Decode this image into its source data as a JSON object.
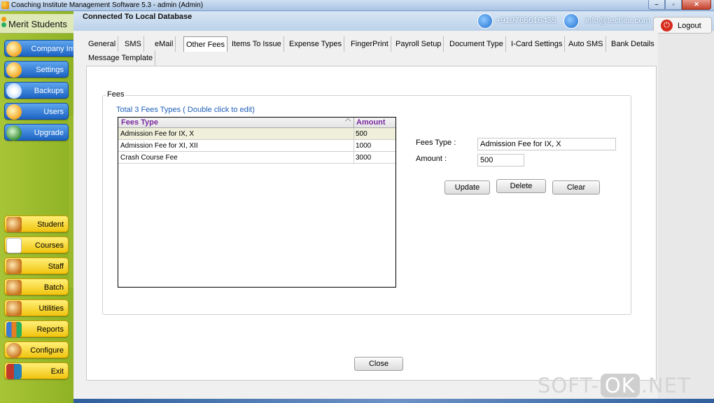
{
  "window": {
    "title": "Coaching Institute Management Software 5.3  -  admin (Admin)",
    "minimize_symbol": "–",
    "restore_symbol": "▫",
    "close_symbol": "✕"
  },
  "sidebar": {
    "brand": "Merit Students",
    "top_items": [
      {
        "label": "Company Info",
        "icon": "folder-icon"
      },
      {
        "label": "Settings",
        "icon": "gear-icon"
      },
      {
        "label": "Backups",
        "icon": "disc-icon"
      },
      {
        "label": "Users",
        "icon": "users-icon"
      },
      {
        "label": "Upgrade",
        "icon": "upgrade-icon"
      }
    ],
    "bottom_items": [
      {
        "label": "Student",
        "icon": "students-icon"
      },
      {
        "label": "Courses",
        "icon": "document-icon"
      },
      {
        "label": "Staff",
        "icon": "staff-icon"
      },
      {
        "label": "Batch",
        "icon": "batch-icon"
      },
      {
        "label": "Utilities",
        "icon": "toolbox-icon"
      },
      {
        "label": "Reports",
        "icon": "chart-icon"
      },
      {
        "label": "Configure",
        "icon": "configure-icon"
      },
      {
        "label": "Exit",
        "icon": "exit-icon"
      }
    ]
  },
  "header": {
    "connection": "Connected To  Local Database",
    "phone": "+919766616435",
    "email": "info@techior.com",
    "logout_label": "Logout"
  },
  "tabs": [
    {
      "label": "General"
    },
    {
      "label": "SMS"
    },
    {
      "label": "eMail"
    },
    {
      "label": "Other Fees",
      "active": true
    },
    {
      "label": "Items To Issue"
    },
    {
      "label": "Expense Types"
    },
    {
      "label": "FingerPrint"
    },
    {
      "label": "Payroll Setup"
    },
    {
      "label": "Document Type"
    },
    {
      "label": "I-Card Settings"
    },
    {
      "label": "Auto SMS"
    },
    {
      "label": "Bank Details"
    },
    {
      "label": "Message Template"
    }
  ],
  "fees": {
    "group_title": "Fees",
    "count_label": "Total 3 Fees Types ( Double click to edit)",
    "columns": [
      "Fees Type",
      "Amount"
    ],
    "rows": [
      {
        "type": "Admission Fee for IX, X",
        "amount": "500",
        "selected": true
      },
      {
        "type": "Admission Fee for XI, XII",
        "amount": "1000"
      },
      {
        "type": "Crash Course Fee",
        "amount": "3000"
      }
    ],
    "form": {
      "fees_type_label": "Fees Type :",
      "fees_type_value": "Admission Fee for IX, X",
      "amount_label": "Amount :",
      "amount_value": "500"
    },
    "buttons": {
      "update": "Update",
      "delete": "Delete",
      "clear": "Clear"
    }
  },
  "footer": {
    "close_label": "Close"
  },
  "watermark": {
    "left": "SOFT-",
    "mid": "OK",
    "right": ".NET"
  },
  "colors": {
    "sidebar_green": "#9ab92c",
    "nav_blue": "#1c63c4",
    "nav_yellow": "#f1c40f",
    "link_blue": "#1f5fb8",
    "column_header": "#7a2aa0",
    "selected_row": "#efefdb"
  }
}
